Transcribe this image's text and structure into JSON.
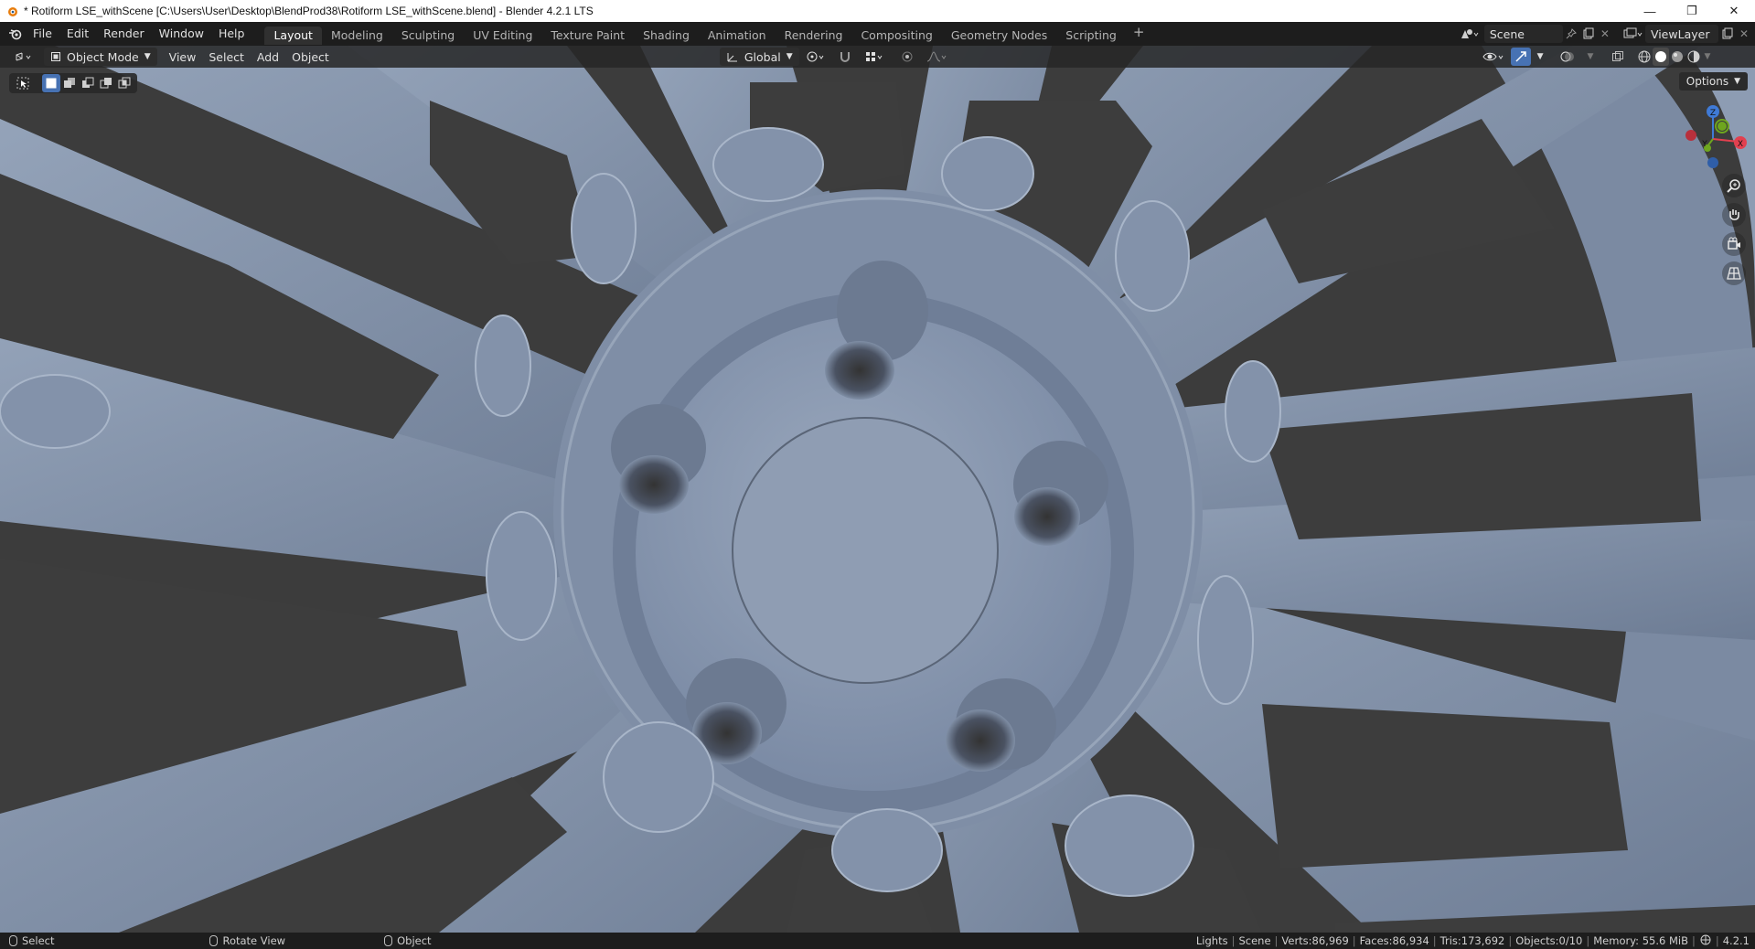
{
  "window": {
    "title": "* Rotiform LSE_withScene [C:\\Users\\User\\Desktop\\BlendProd38\\Rotiform LSE_withScene.blend] - Blender 4.2.1 LTS",
    "controls": {
      "minimize": "—",
      "maximize": "❐",
      "close": "✕"
    }
  },
  "menubar": {
    "items": [
      "File",
      "Edit",
      "Render",
      "Window",
      "Help"
    ]
  },
  "workspaces": {
    "tabs": [
      "Layout",
      "Modeling",
      "Sculpting",
      "UV Editing",
      "Texture Paint",
      "Shading",
      "Animation",
      "Rendering",
      "Compositing",
      "Geometry Nodes",
      "Scripting"
    ],
    "active": "Layout",
    "add_label": "+"
  },
  "scene": {
    "name": "Scene",
    "view_layer": "ViewLayer"
  },
  "viewport_header": {
    "mode": "Object Mode",
    "menus": [
      "View",
      "Select",
      "Add",
      "Object"
    ],
    "transform_orientation": "Global"
  },
  "viewport": {
    "options_label": "Options",
    "gizmo_axes": {
      "z": "Z",
      "y": "Y",
      "x": "X"
    },
    "colors": {
      "wheel": "#8796ad",
      "wheel_dark": "#5f6b7c",
      "background": "#3a3a3a",
      "axis_x": "#e2404f",
      "axis_y": "#6ea61e",
      "axis_z": "#3f7ad6"
    }
  },
  "statusbar": {
    "left": [
      {
        "icon": "mouse-left-icon",
        "label": "Select"
      },
      {
        "icon": "mouse-middle-icon",
        "label": "Rotate View"
      },
      {
        "icon": "mouse-right-icon",
        "label": "Object"
      }
    ],
    "stats": [
      "Lights",
      "Scene",
      "Verts:86,969",
      "Faces:86,934",
      "Tris:173,692",
      "Objects:0/10",
      "Memory: 55.6 MiB"
    ],
    "version": "4.2.1"
  }
}
